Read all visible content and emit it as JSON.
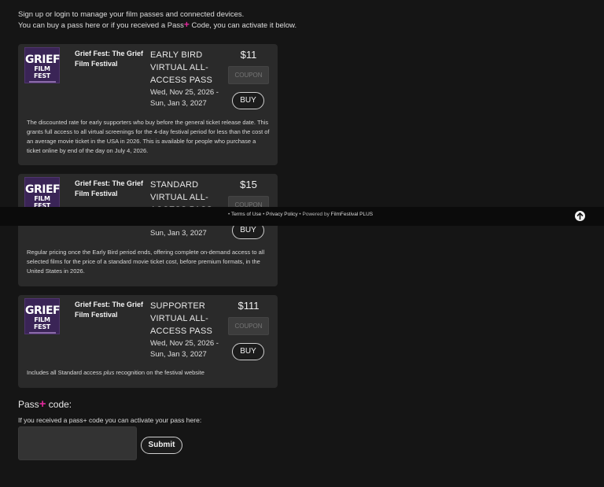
{
  "intro": {
    "line1": "Sign up or login to manage your film passes and connected devices.",
    "line2_pre": "You can buy a pass here or if you received a Pass",
    "line2_plus": "+",
    "line2_post": " Code, you can activate it below."
  },
  "logo": {
    "line1": "GRIEF",
    "line2": "FILM FEST"
  },
  "passes": [
    {
      "festival": "Grief Fest: The Grief Film Festival",
      "name": "EARLY BIRD VIRTUAL ALL-ACCESS PASS",
      "dates": "Wed, Nov 25, 2026 - Sun, Jan 3, 2027",
      "price": "$11",
      "coupon": "COUPON",
      "buy": "BUY",
      "description": "The discounted rate for early supporters who buy before the general ticket release date. This grants full access to all virtual screenings for the 4-day festival period for less than the cost of an average movie ticket in the USA in 2026. This is available for people who purchase a ticket online by end of the day on July 4, 2026."
    },
    {
      "festival": "Grief Fest: The Grief Film Festival",
      "name": "STANDARD VIRTUAL ALL-ACCESS PASS",
      "dates": "Wed, Nov 25, 2026 - Sun, Jan 3, 2027",
      "price": "$15",
      "coupon": "COUPON",
      "buy": "BUY",
      "description": "Regular pricing once the Early Bird period ends, offering complete on-demand access to all selected films for the price of  a standard movie ticket cost, before premium formats, in the United States in 2026."
    },
    {
      "festival": "Grief Fest: The Grief Film Festival",
      "name": "SUPPORTER VIRTUAL ALL-ACCESS PASS",
      "dates": "Wed, Nov 25, 2026 - Sun, Jan 3, 2027",
      "price": "$111",
      "coupon": "COUPON",
      "buy": "BUY",
      "description_pre": "Includes all Standard access ",
      "description_em": "plus",
      "description_post": " recognition on the festival website"
    }
  ],
  "footer": {
    "terms": "Terms of Use",
    "privacy": "Privacy Policy",
    "powered": "Powered by",
    "brand": "FilmFestival PLUS"
  },
  "passcode": {
    "heading_pre": "Pass",
    "heading_plus": "+",
    "heading_post": " code:",
    "subtitle": "If you received a pass+ code you can activate your pass here:",
    "value": "",
    "submit": "Submit"
  },
  "colors": {
    "accent": "#e0299b",
    "card": "#2a2a2a",
    "background": "#151515"
  }
}
